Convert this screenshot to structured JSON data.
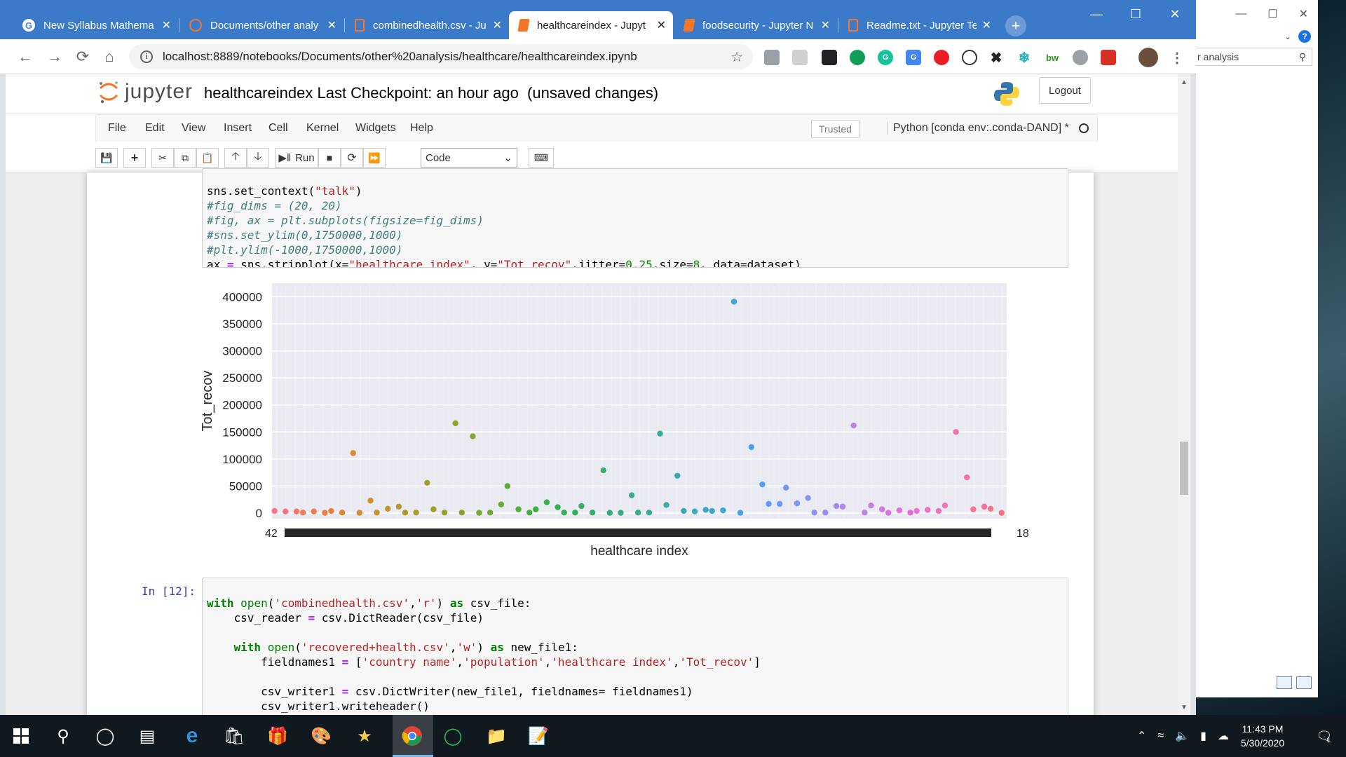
{
  "browser": {
    "tabs": [
      {
        "title": "New Syllabus Mathema",
        "icon": "google-icon"
      },
      {
        "title": "Documents/other analy",
        "icon": "jupyter-icon"
      },
      {
        "title": "combinedhealth.csv - Ju",
        "icon": "file-icon"
      },
      {
        "title": "healthcareindex - Jupyt",
        "icon": "notebook-icon",
        "active": true
      },
      {
        "title": "foodsecurity - Jupyter N",
        "icon": "notebook-icon"
      },
      {
        "title": "Readme.txt - Jupyter Te",
        "icon": "file-icon"
      }
    ],
    "url": "localhost:8889/notebooks/Documents/other%20analysis/healthcare/healthcareindex.ipynb"
  },
  "side_window": {
    "search_value": "r analysis"
  },
  "jupyter": {
    "logo_text": "jupyter",
    "notebook_name": "healthcareindex",
    "checkpoint": "Last Checkpoint: an hour ago",
    "unsaved": "(unsaved changes)",
    "logout_label": "Logout",
    "menu": [
      "File",
      "Edit",
      "View",
      "Insert",
      "Cell",
      "Kernel",
      "Widgets",
      "Help"
    ],
    "trusted_label": "Trusted",
    "kernel_label": "Python [conda env:.conda-DAND] *",
    "run_label": "Run",
    "cell_type": "Code"
  },
  "cells": {
    "cell1_lines": [
      "sns.set_context(\"talk\")",
      "#fig_dims = (20, 20)",
      "#fig, ax = plt.subplots(figsize=fig_dims)",
      "#sns.set_ylim(0,1750000,1000)",
      "#plt.ylim(-1000,1750000,1000)",
      "ax = sns.stripplot(x=\"healthcare index\", y=\"Tot_recov\",jitter=0.25,size=8, data=dataset)"
    ],
    "cell2_prompt": "In [12]:",
    "cell2_lines": [
      "with open('combinedhealth.csv','r') as csv_file:",
      "    csv_reader = csv.DictReader(csv_file)",
      "",
      "    with open('recovered+health.csv','w') as new_file1:",
      "        fieldnames1 = ['country name','population','healthcare index','Tot_recov']",
      "",
      "        csv_writer1 = csv.DictWriter(new_file1, fieldnames= fieldnames1)",
      "        csv_writer1.writeheader()"
    ]
  },
  "chart_data": {
    "type": "scatter",
    "subtype": "stripplot",
    "xlabel": "healthcare index",
    "ylabel": "Tot_recov",
    "ylim": [
      0,
      420000
    ],
    "yticks": [
      0,
      50000,
      100000,
      150000,
      200000,
      250000,
      300000,
      350000,
      400000
    ],
    "xtick_first": "42",
    "xtick_last": "18",
    "grid": true,
    "background": "#eaeaf2",
    "points": [
      {
        "i": 0,
        "y": 4000,
        "c": "#f77189"
      },
      {
        "i": 1,
        "y": 3000,
        "c": "#f7727c"
      },
      {
        "i": 2,
        "y": 3000,
        "c": "#f7746d"
      },
      {
        "i": 3,
        "y": 1000,
        "c": "#f57a58"
      },
      {
        "i": 4,
        "y": 3000,
        "c": "#f27b4e"
      },
      {
        "i": 5,
        "y": 500,
        "c": "#ee7e41"
      },
      {
        "i": 6,
        "y": 4000,
        "c": "#e7823a"
      },
      {
        "i": 7,
        "y": 1000,
        "c": "#e08632"
      },
      {
        "i": 8,
        "y": 111000,
        "c": "#d98a2f"
      },
      {
        "i": 9,
        "y": 500,
        "c": "#d28d2d"
      },
      {
        "i": 10,
        "y": 23000,
        "c": "#cc902c"
      },
      {
        "i": 11,
        "y": 1000,
        "c": "#c6922c"
      },
      {
        "i": 12,
        "y": 8000,
        "c": "#c0952c"
      },
      {
        "i": 13,
        "y": 12000,
        "c": "#b9972c"
      },
      {
        "i": 14,
        "y": 1000,
        "c": "#b2992c"
      },
      {
        "i": 15,
        "y": 1000,
        "c": "#ab9b2c"
      },
      {
        "i": 16,
        "y": 56000,
        "c": "#a59d2d"
      },
      {
        "i": 17,
        "y": 7000,
        "c": "#9f9f2d"
      },
      {
        "i": 18,
        "y": 1000,
        "c": "#98a12e"
      },
      {
        "i": 19,
        "y": 166000,
        "c": "#91a32e"
      },
      {
        "i": 20,
        "y": 1000,
        "c": "#8aa52f"
      },
      {
        "i": 21,
        "y": 142000,
        "c": "#82a630"
      },
      {
        "i": 22,
        "y": 500,
        "c": "#7aa831"
      },
      {
        "i": 23,
        "y": 1000,
        "c": "#70aa32"
      },
      {
        "i": 24,
        "y": 16000,
        "c": "#65ac33"
      },
      {
        "i": 25,
        "y": 50000,
        "c": "#58ae35"
      },
      {
        "i": 26,
        "y": 7000,
        "c": "#4fb036"
      },
      {
        "i": 27,
        "y": 1000,
        "c": "#45b03a"
      },
      {
        "i": 28,
        "y": 7000,
        "c": "#3cb040"
      },
      {
        "i": 29,
        "y": 20000,
        "c": "#36b047"
      },
      {
        "i": 30,
        "y": 11000,
        "c": "#33b04e"
      },
      {
        "i": 31,
        "y": 1000,
        "c": "#33b055"
      },
      {
        "i": 32,
        "y": 1000,
        "c": "#33b05c"
      },
      {
        "i": 33,
        "y": 13000,
        "c": "#34af63"
      },
      {
        "i": 34,
        "y": 1000,
        "c": "#34af6a"
      },
      {
        "i": 35,
        "y": 79000,
        "c": "#35ae71"
      },
      {
        "i": 36,
        "y": 500,
        "c": "#35ae78"
      },
      {
        "i": 37,
        "y": 500,
        "c": "#36ad7f"
      },
      {
        "i": 38,
        "y": 33000,
        "c": "#36ad86"
      },
      {
        "i": 39,
        "y": 1000,
        "c": "#37ad8d"
      },
      {
        "i": 40,
        "y": 1000,
        "c": "#37ac94"
      },
      {
        "i": 41,
        "y": 147000,
        "c": "#38ab9c"
      },
      {
        "i": 42,
        "y": 15000,
        "c": "#38aba3"
      },
      {
        "i": 43,
        "y": 69000,
        "c": "#39aaaa"
      },
      {
        "i": 44,
        "y": 4000,
        "c": "#3aa9b2"
      },
      {
        "i": 45,
        "y": 3000,
        "c": "#3ba9ba"
      },
      {
        "i": 46,
        "y": 6000,
        "c": "#3ca8c2"
      },
      {
        "i": 47,
        "y": 4000,
        "c": "#3ea7c9"
      },
      {
        "i": 48,
        "y": 5000,
        "c": "#40a6d2"
      },
      {
        "i": 49,
        "y": 391000,
        "c": "#42a5da"
      },
      {
        "i": 50,
        "y": 500,
        "c": "#45a4e3"
      },
      {
        "i": 51,
        "y": 122000,
        "c": "#4aa2ea"
      },
      {
        "i": 52,
        "y": 53000,
        "c": "#52a0f0"
      },
      {
        "i": 53,
        "y": 17000,
        "c": "#5c9ef5"
      },
      {
        "i": 54,
        "y": 17000,
        "c": "#679bf7"
      },
      {
        "i": 55,
        "y": 47000,
        "c": "#7298f6"
      },
      {
        "i": 56,
        "y": 18000,
        "c": "#7c96f5"
      },
      {
        "i": 57,
        "y": 28000,
        "c": "#8693f5"
      },
      {
        "i": 58,
        "y": 1000,
        "c": "#9090f4"
      },
      {
        "i": 59,
        "y": 1000,
        "c": "#9a8df2"
      },
      {
        "i": 60,
        "y": 13000,
        "c": "#a38af0"
      },
      {
        "i": 61,
        "y": 12000,
        "c": "#ac87ee"
      },
      {
        "i": 62,
        "y": 162000,
        "c": "#b584ec"
      },
      {
        "i": 63,
        "y": 1000,
        "c": "#be80ea"
      },
      {
        "i": 64,
        "y": 14000,
        "c": "#c67de7"
      },
      {
        "i": 65,
        "y": 7000,
        "c": "#cf79e4"
      },
      {
        "i": 66,
        "y": 500,
        "c": "#d875e0"
      },
      {
        "i": 67,
        "y": 5000,
        "c": "#e071db"
      },
      {
        "i": 68,
        "y": 1000,
        "c": "#e76dd5"
      },
      {
        "i": 69,
        "y": 4000,
        "c": "#ec6ece"
      },
      {
        "i": 70,
        "y": 6000,
        "c": "#ef6fc6"
      },
      {
        "i": 71,
        "y": 4000,
        "c": "#f170bd"
      },
      {
        "i": 72,
        "y": 14000,
        "c": "#f371b4"
      },
      {
        "i": 73,
        "y": 150000,
        "c": "#f571ab"
      },
      {
        "i": 74,
        "y": 66000,
        "c": "#f672a2"
      },
      {
        "i": 75,
        "y": 7000,
        "c": "#f67299"
      },
      {
        "i": 76,
        "y": 12000,
        "c": "#f77291"
      },
      {
        "i": 77,
        "y": 8000,
        "c": "#f7738a"
      },
      {
        "i": 78,
        "y": 500,
        "c": "#f77484"
      }
    ]
  },
  "taskbar": {
    "time": "11:43 PM",
    "date": "5/30/2020",
    "notifications": "1"
  }
}
